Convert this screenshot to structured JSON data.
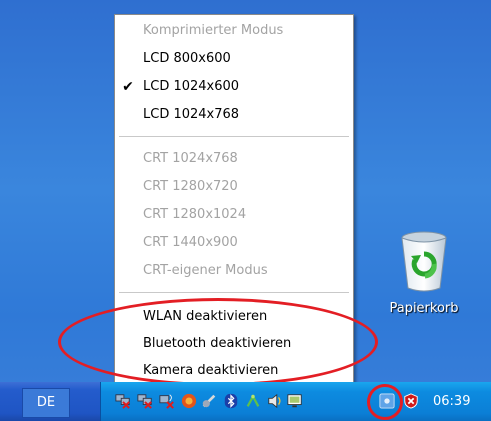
{
  "menu": {
    "items": [
      {
        "label": "Komprimierter Modus",
        "disabled": true,
        "checked": false
      },
      {
        "label": "LCD 800x600",
        "disabled": false,
        "checked": false
      },
      {
        "label": "LCD 1024x600",
        "disabled": false,
        "checked": true
      },
      {
        "label": "LCD 1024x768",
        "disabled": false,
        "checked": false
      },
      {
        "label": "CRT 1024x768",
        "disabled": true,
        "checked": false
      },
      {
        "label": "CRT 1280x720",
        "disabled": true,
        "checked": false
      },
      {
        "label": "CRT 1280x1024",
        "disabled": true,
        "checked": false
      },
      {
        "label": "CRT 1440x900",
        "disabled": true,
        "checked": false
      },
      {
        "label": "CRT-eigener Modus",
        "disabled": true,
        "checked": false
      },
      {
        "label": "WLAN deaktivieren",
        "disabled": false,
        "checked": false
      },
      {
        "label": "Bluetooth deaktivieren",
        "disabled": false,
        "checked": false
      },
      {
        "label": "Kamera deaktivieren",
        "disabled": false,
        "checked": false
      }
    ],
    "check_mark": "✔"
  },
  "desktop": {
    "recycle_bin_label": "Papierkorb"
  },
  "taskbar": {
    "language": "DE",
    "clock": "06:39"
  },
  "colors": {
    "annotation_red": "#e31e24",
    "desktop_blue": "#3a86dd",
    "taskbar_blue": "#245ccc",
    "tray_blue": "#0d8be0"
  },
  "tray_icons": [
    "network-disabled-icon",
    "network-disabled-icon",
    "network-wireless-disabled-icon",
    "security-icon",
    "satellite-icon",
    "bluetooth-icon",
    "antenna-icon",
    "volume-icon",
    "monitor-icon",
    "display-settings-icon",
    "shield-alert-icon"
  ]
}
